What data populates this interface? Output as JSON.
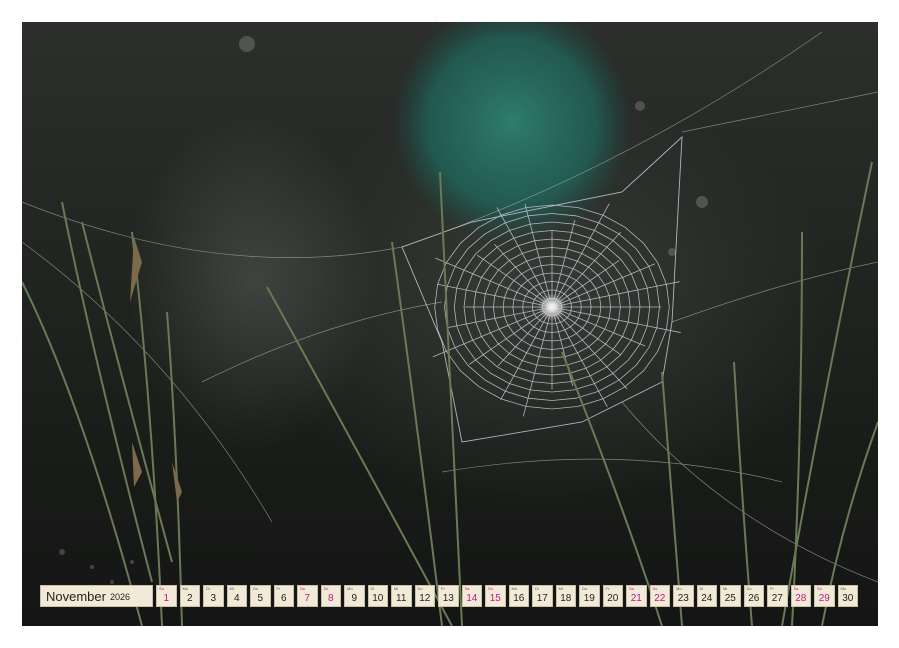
{
  "calendar": {
    "month": "November",
    "year": "2026",
    "days": [
      {
        "wd": "So",
        "num": "1",
        "weekend": true
      },
      {
        "wd": "Mo",
        "num": "2",
        "weekend": false
      },
      {
        "wd": "Di",
        "num": "3",
        "weekend": false
      },
      {
        "wd": "Mi",
        "num": "4",
        "weekend": false
      },
      {
        "wd": "Do",
        "num": "5",
        "weekend": false
      },
      {
        "wd": "Fr",
        "num": "6",
        "weekend": false
      },
      {
        "wd": "Sa",
        "num": "7",
        "weekend": true
      },
      {
        "wd": "So",
        "num": "8",
        "weekend": true
      },
      {
        "wd": "Mo",
        "num": "9",
        "weekend": false
      },
      {
        "wd": "Di",
        "num": "10",
        "weekend": false
      },
      {
        "wd": "Mi",
        "num": "11",
        "weekend": false
      },
      {
        "wd": "Do",
        "num": "12",
        "weekend": false
      },
      {
        "wd": "Fr",
        "num": "13",
        "weekend": false
      },
      {
        "wd": "Sa",
        "num": "14",
        "weekend": true
      },
      {
        "wd": "So",
        "num": "15",
        "weekend": true
      },
      {
        "wd": "Mo",
        "num": "16",
        "weekend": false
      },
      {
        "wd": "Di",
        "num": "17",
        "weekend": false
      },
      {
        "wd": "Mi",
        "num": "18",
        "weekend": false
      },
      {
        "wd": "Do",
        "num": "19",
        "weekend": false
      },
      {
        "wd": "Fr",
        "num": "20",
        "weekend": false
      },
      {
        "wd": "Sa",
        "num": "21",
        "weekend": true
      },
      {
        "wd": "So",
        "num": "22",
        "weekend": true
      },
      {
        "wd": "Mo",
        "num": "23",
        "weekend": false
      },
      {
        "wd": "Di",
        "num": "24",
        "weekend": false
      },
      {
        "wd": "Mi",
        "num": "25",
        "weekend": false
      },
      {
        "wd": "Do",
        "num": "26",
        "weekend": false
      },
      {
        "wd": "Fr",
        "num": "27",
        "weekend": false
      },
      {
        "wd": "Sa",
        "num": "28",
        "weekend": true
      },
      {
        "wd": "So",
        "num": "29",
        "weekend": true
      },
      {
        "wd": "Mo",
        "num": "30",
        "weekend": false
      }
    ]
  },
  "colors": {
    "weekend": "#c0168a",
    "cell_background": "#f2ead6"
  }
}
